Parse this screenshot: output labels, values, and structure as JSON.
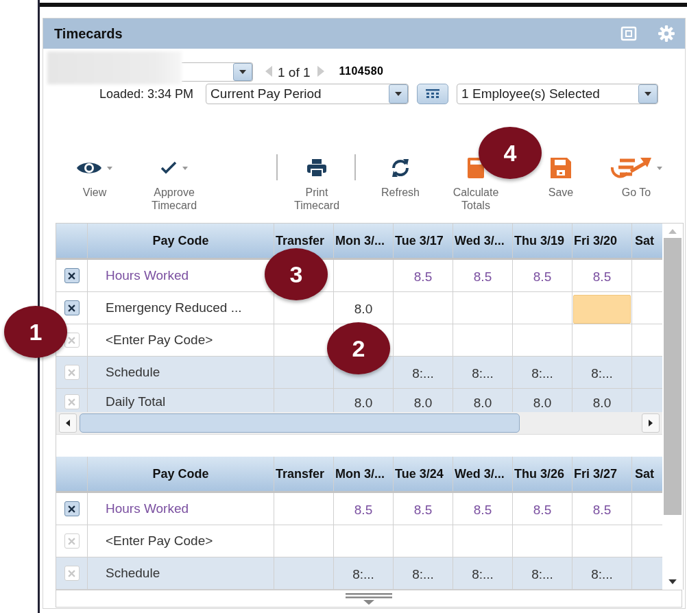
{
  "panel": {
    "title": "Timecards"
  },
  "navigator": {
    "position": "1 of 1",
    "employee_id": "1104580",
    "loaded": "Loaded: 3:34 PM",
    "period": "Current Pay Period",
    "selection": "1 Employee(s) Selected"
  },
  "toolbar": [
    {
      "kind": "view",
      "label": "View",
      "menu": true
    },
    {
      "kind": "approve",
      "label": "Approve\nTimecard",
      "menu": true
    },
    {
      "kind": "print",
      "label": "Print\nTimecard",
      "menu": false
    },
    {
      "kind": "refresh",
      "label": "Refresh",
      "menu": false
    },
    {
      "kind": "calculate",
      "label": "Calculate\nTotals",
      "menu": false
    },
    {
      "kind": "save",
      "label": "Save",
      "menu": false
    },
    {
      "kind": "goto",
      "label": "Go To",
      "menu": true
    }
  ],
  "grids": [
    {
      "columns": [
        "Pay Code",
        "Transfer",
        "Mon 3/...",
        "Tue 3/17",
        "Wed 3/...",
        "Thu 3/19",
        "Fri 3/20",
        "Sat"
      ],
      "rows": [
        {
          "kind": "worked",
          "enabled": true,
          "cells": [
            "Hours Worked",
            null,
            null,
            "8.5",
            "8.5",
            "8.5",
            "8.5",
            null
          ]
        },
        {
          "kind": "entry",
          "enabled": true,
          "cells": [
            "Emergency Reduced ...",
            null,
            "8.0",
            null,
            null,
            null,
            {
              "highlighted": true
            },
            null
          ]
        },
        {
          "kind": "entry",
          "enabled": false,
          "cells": [
            "<Enter Pay Code>",
            null,
            null,
            null,
            null,
            null,
            null,
            null
          ]
        },
        {
          "kind": "summary",
          "enabled": false,
          "cells": [
            "Schedule",
            null,
            null,
            "8:...",
            "8:...",
            "8:...",
            "8:...",
            null
          ]
        },
        {
          "kind": "summary",
          "enabled": false,
          "cells": [
            "Daily Total",
            null,
            "8.0",
            "8.0",
            "8.0",
            "8.0",
            "8.0",
            null
          ]
        }
      ]
    },
    {
      "columns": [
        "Pay Code",
        "Transfer",
        "Mon 3/...",
        "Tue 3/24",
        "Wed 3/...",
        "Thu 3/26",
        "Fri 3/27",
        "Sat"
      ],
      "rows": [
        {
          "kind": "worked",
          "enabled": true,
          "cells": [
            "Hours Worked",
            null,
            "8.5",
            "8.5",
            "8.5",
            "8.5",
            "8.5",
            null
          ]
        },
        {
          "kind": "entry",
          "enabled": false,
          "cells": [
            "<Enter Pay Code>",
            null,
            null,
            null,
            null,
            null,
            null,
            null
          ]
        },
        {
          "kind": "summary",
          "enabled": false,
          "cells": [
            "Schedule",
            null,
            "8:...",
            "8:...",
            "8:...",
            "8:...",
            "8:...",
            null
          ]
        }
      ]
    }
  ],
  "callouts": [
    "1",
    "2",
    "3",
    "4"
  ]
}
